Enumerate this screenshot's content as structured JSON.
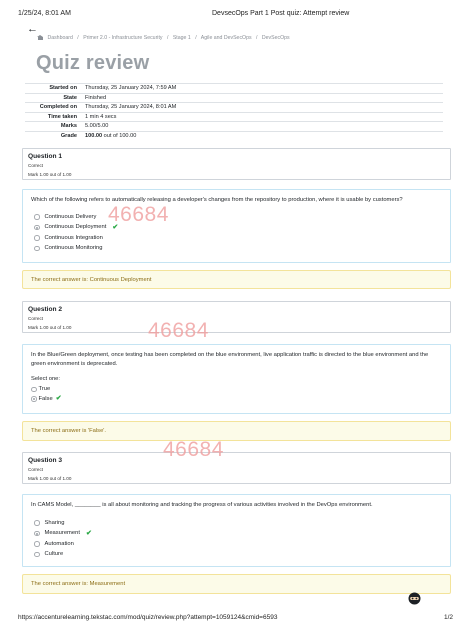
{
  "header": {
    "datetime": "1/25/24, 8:01 AM",
    "doc_title": "DevsecOps Part 1 Post quiz: Attempt review"
  },
  "nav": {
    "back_icon": "back-arrow-icon",
    "breadcrumb": [
      "Dashboard",
      "Primer 2.0 - Infrastructure Security",
      "Stage 1",
      "Agile and DevSecOps",
      "DevSecOps"
    ],
    "separator": "/"
  },
  "page_title": "Quiz review",
  "summary": [
    {
      "label": "Started on",
      "value": "Thursday, 25 January 2024, 7:59 AM"
    },
    {
      "label": "State",
      "value": "Finished"
    },
    {
      "label": "Completed on",
      "value": "Thursday, 25 January 2024, 8:01 AM"
    },
    {
      "label": "Time taken",
      "value": "1 min 4 secs"
    },
    {
      "label": "Marks",
      "value": "5.00/5.00"
    },
    {
      "label": "Grade",
      "value_bold": "100.00",
      "value_rest": " out of 100.00"
    }
  ],
  "questions": [
    {
      "title": "Question 1",
      "status": "Correct",
      "mark": "Mark 1.00 out of 1.00",
      "text": "Which of the following refers to automatically releasing a developer's changes from the repository to production, where it is usable by customers?",
      "options": [
        "Continuous Delivery",
        "Continuous Deployment",
        "Continuous Integration",
        "Continuous Monitoring"
      ],
      "selected_index": 1,
      "feedback": "The correct answer is: Continuous Deployment"
    },
    {
      "title": "Question 2",
      "status": "Correct",
      "mark": "Mark 1.00 out of 1.00",
      "text": "In the Blue/Green deployment, once testing has been completed on the blue environment, live application traffic is directed to the blue environment and the green environment is deprecated.",
      "select_one": "Select one:",
      "options": [
        "True",
        "False"
      ],
      "selected_index": 1,
      "feedback": "The correct answer is 'False'."
    },
    {
      "title": "Question 3",
      "status": "Correct",
      "mark": "Mark 1.00 out of 1.00",
      "text": "In CAMS Model, ________ is all about monitoring and tracking the progress of various activities involved in the DevOps environment.",
      "options": [
        "Sharing",
        "Measurement",
        "Automation",
        "Culture"
      ],
      "selected_index": 1,
      "feedback": "The correct answer is: Measurement"
    }
  ],
  "watermark": "46684",
  "footer": {
    "url": "https://accenturelearning.tekstac.com/mod/quiz/review.php?attempt=1059124&cmid=6593",
    "page": "1/2"
  },
  "icons": {
    "check": "check-icon",
    "avatar": "ninja-avatar-icon"
  },
  "colors": {
    "check": "#2aa845",
    "feedback_bg": "#fcfbe8",
    "feedback_text": "#8b6c14",
    "question_border": "#c5e4f3",
    "watermark": "#ef9e9e"
  }
}
